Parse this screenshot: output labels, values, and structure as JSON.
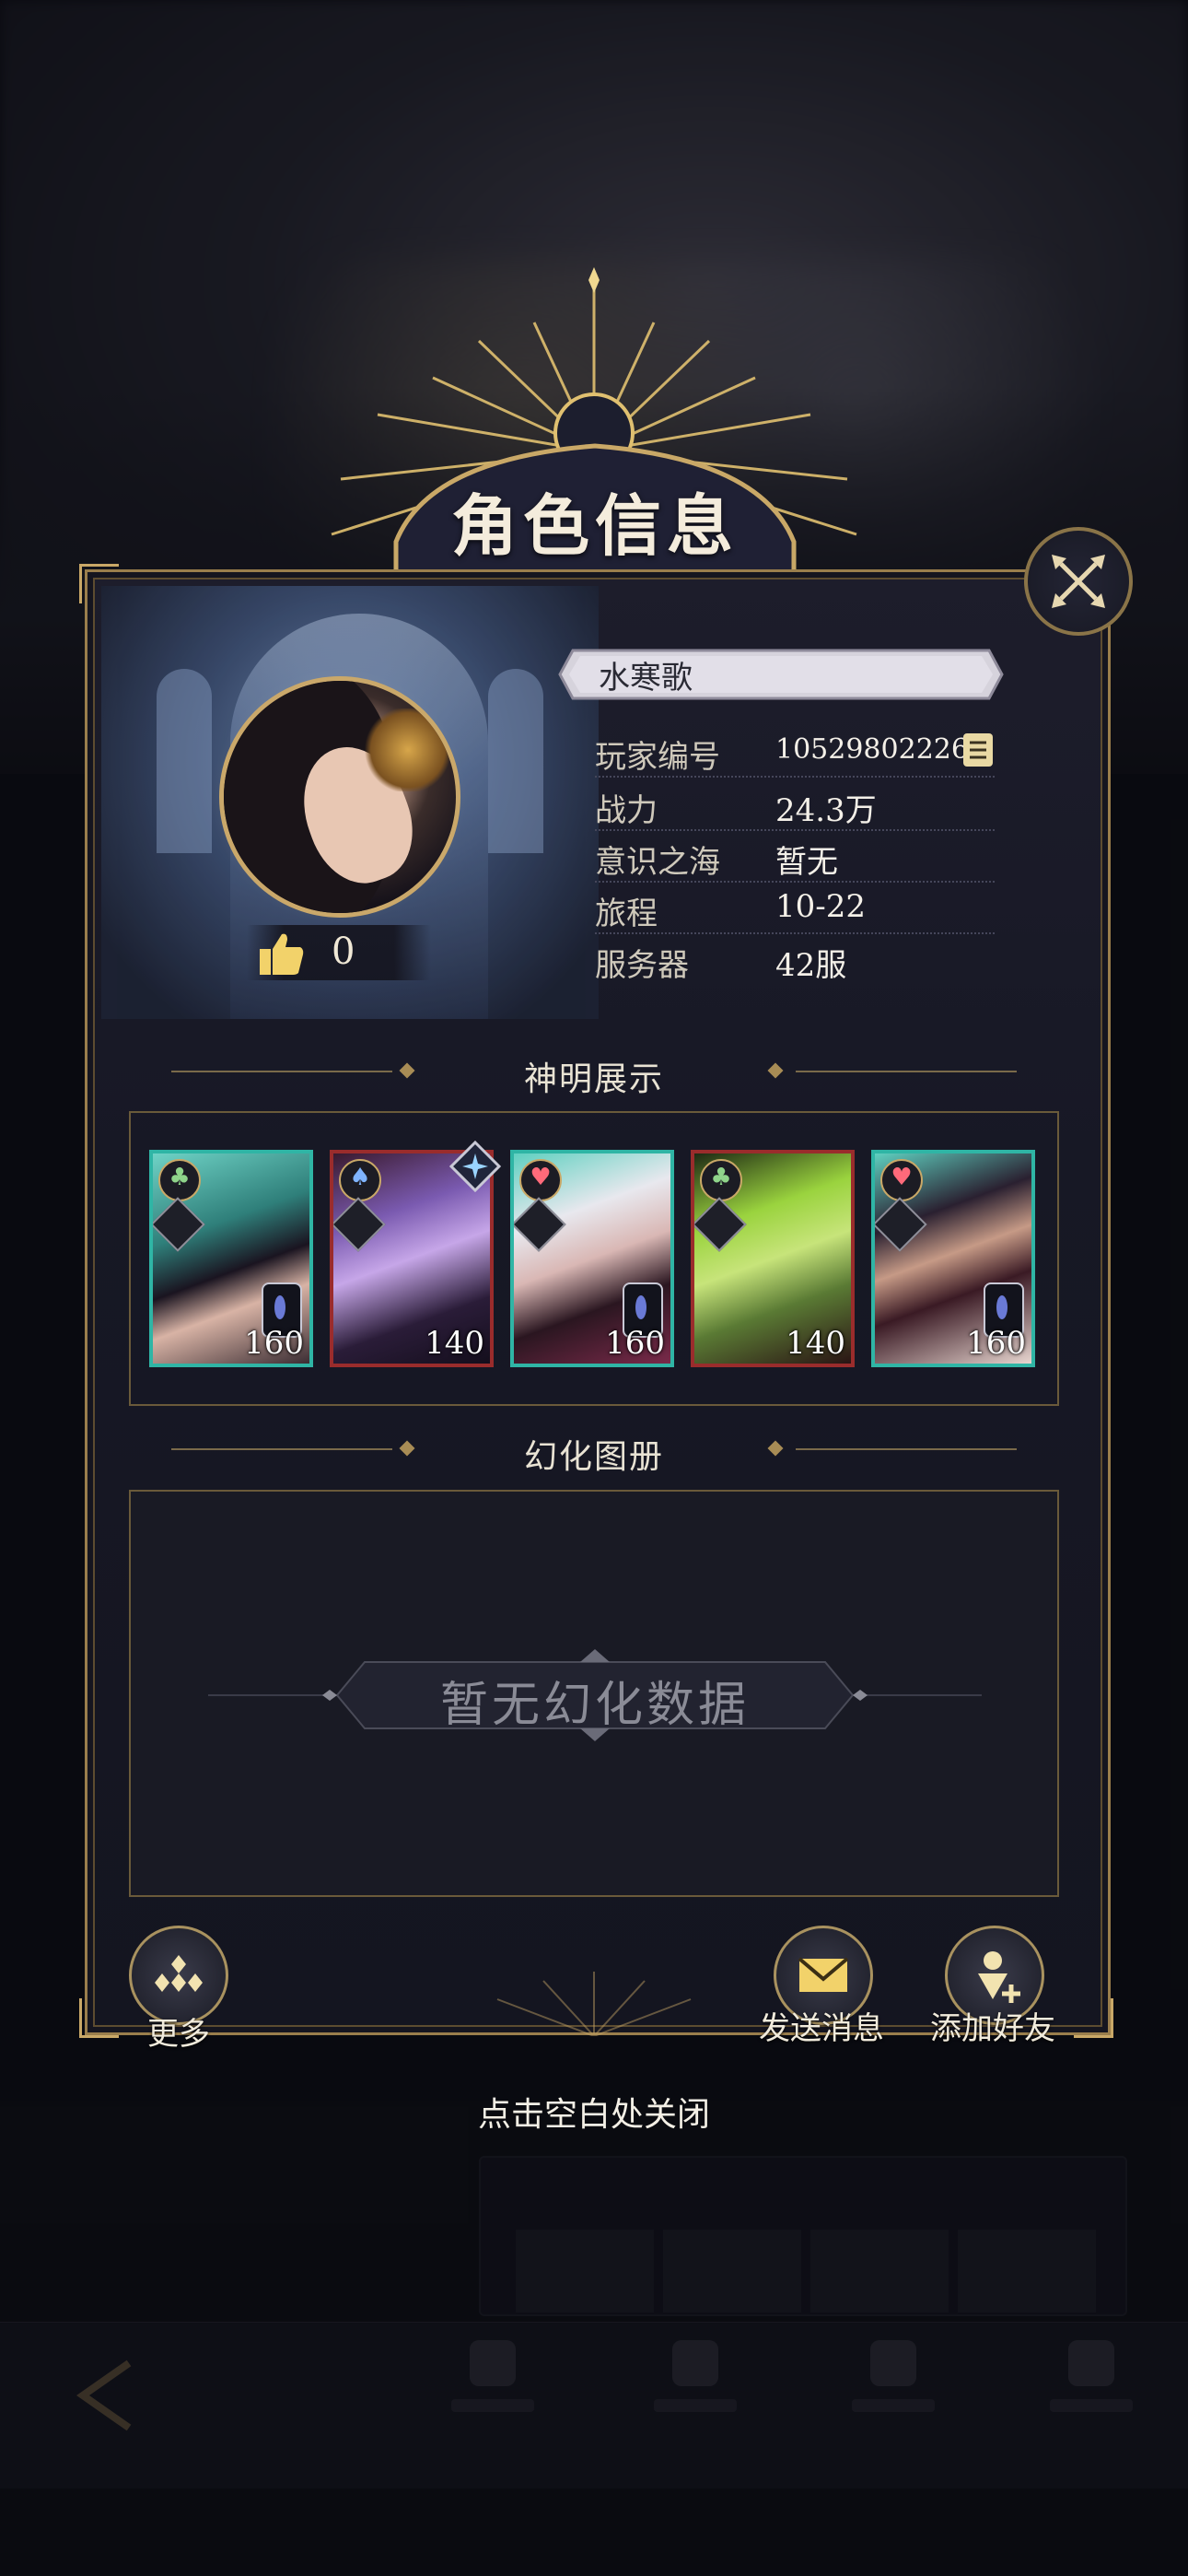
{
  "dialog": {
    "title": "角色信息",
    "close_hint": "点击空白处关闭"
  },
  "profile": {
    "name": "水寒歌",
    "likes": "0",
    "fields": [
      {
        "label": "玩家编号",
        "value": "10529802226"
      },
      {
        "label": "战力",
        "value": "24.3万"
      },
      {
        "label": "意识之海",
        "value": "暂无"
      },
      {
        "label": "旅程",
        "value": "10-22"
      },
      {
        "label": "服务器",
        "value": "42服"
      }
    ]
  },
  "sections": {
    "heroes_title": "神明展示",
    "album_title": "幻化图册",
    "album_empty": "暂无幻化数据"
  },
  "heroes": [
    {
      "level": "160",
      "suit": "♣",
      "frame": "teal"
    },
    {
      "level": "140",
      "suit": "♠",
      "frame": "red"
    },
    {
      "level": "160",
      "suit": "♥",
      "frame": "teal"
    },
    {
      "level": "140",
      "suit": "♣",
      "frame": "red"
    },
    {
      "level": "160",
      "suit": "♥",
      "frame": "teal"
    }
  ],
  "actions": {
    "more": "更多",
    "send_message": "发送消息",
    "add_friend": "添加好友"
  },
  "colors": {
    "gold": "#c9a867",
    "panel": "#171825",
    "teal_frame": "#2fb5a5",
    "red_frame": "#9a2c2c"
  }
}
